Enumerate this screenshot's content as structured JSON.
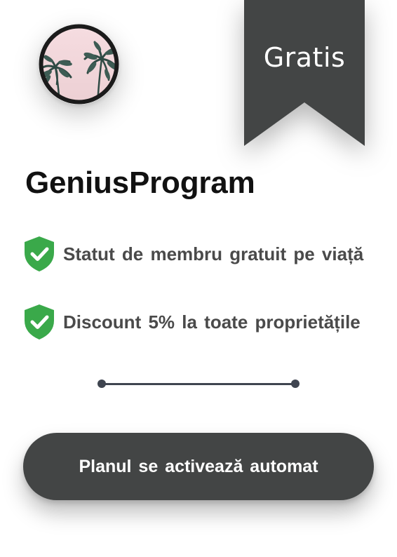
{
  "ribbon": {
    "label": "Gratis",
    "color": "#434545"
  },
  "avatar": {
    "icon": "palm-trees-photo",
    "border_color": "#1b1b1b",
    "sky_color": "#f3d6da"
  },
  "plan": {
    "title": "GeniusProgram"
  },
  "features": [
    {
      "icon": "shield-check-icon",
      "text": "Statut de membru gratuit pe viață"
    },
    {
      "icon": "shield-check-icon",
      "text": "Discount 5% la toate proprietățile"
    }
  ],
  "colors": {
    "check_green": "#3aa94a",
    "feature_text": "#4a4a4a",
    "button_bg": "#434545",
    "slider": "#3f4550"
  },
  "cta": {
    "label": "Planul se activează automat"
  }
}
